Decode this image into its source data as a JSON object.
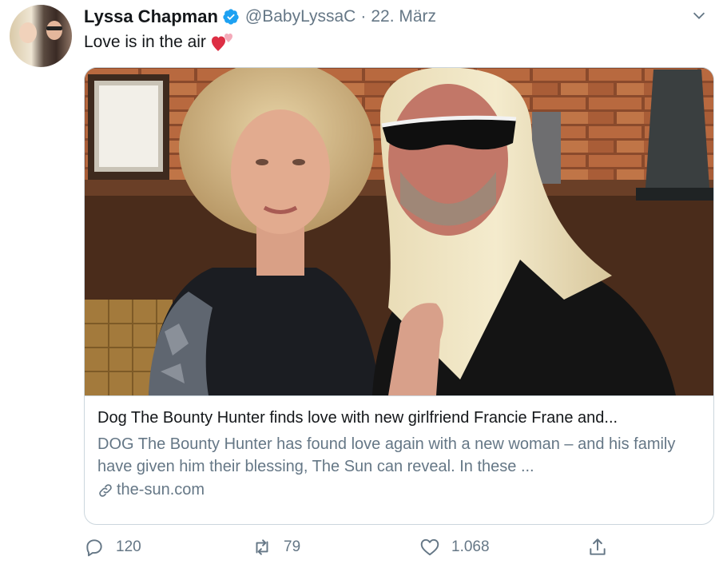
{
  "tweet": {
    "author_name": "Lyssa Chapman",
    "handle": "@BabyLyssaC",
    "separator": "·",
    "date": "22. März",
    "text": "Love is in the air",
    "emoji_icon": "two-hearts-icon",
    "verified_icon": "verified-badge-icon",
    "menu_icon": "chevron-down-icon"
  },
  "card": {
    "title": "Dog The Bounty Hunter finds love with new girlfriend Francie Frane and...",
    "description": "DOG The Bounty Hunter has found love again with a new woman – and his family have given him their blessing, The Sun can reveal. In these ...",
    "domain": "the-sun.com",
    "link_icon": "link-icon"
  },
  "actions": {
    "reply": {
      "icon": "reply-icon",
      "count": "120"
    },
    "retweet": {
      "icon": "retweet-icon",
      "count": "79"
    },
    "like": {
      "icon": "heart-icon",
      "count": "1.068"
    },
    "share": {
      "icon": "share-icon"
    }
  },
  "colors": {
    "primary_text": "#14171a",
    "secondary_text": "#657786",
    "verified_blue": "#1da1f2",
    "heart_red": "#e0245e",
    "border": "#ccd6dd"
  }
}
